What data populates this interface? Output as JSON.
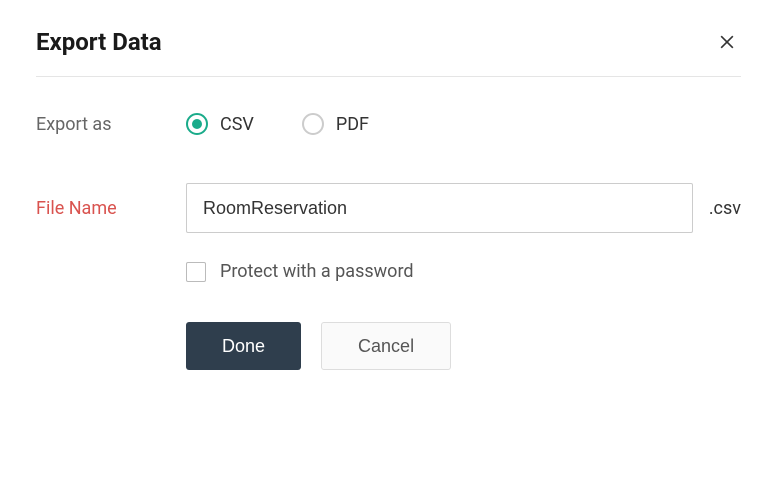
{
  "dialog": {
    "title": "Export Data"
  },
  "exportAs": {
    "label": "Export as",
    "options": {
      "csv": {
        "label": "CSV",
        "selected": true
      },
      "pdf": {
        "label": "PDF",
        "selected": false
      }
    }
  },
  "fileName": {
    "label": "File Name",
    "value": "RoomReservation",
    "extension": ".csv"
  },
  "protect": {
    "label": "Protect with a password",
    "checked": false
  },
  "buttons": {
    "done": "Done",
    "cancel": "Cancel"
  }
}
